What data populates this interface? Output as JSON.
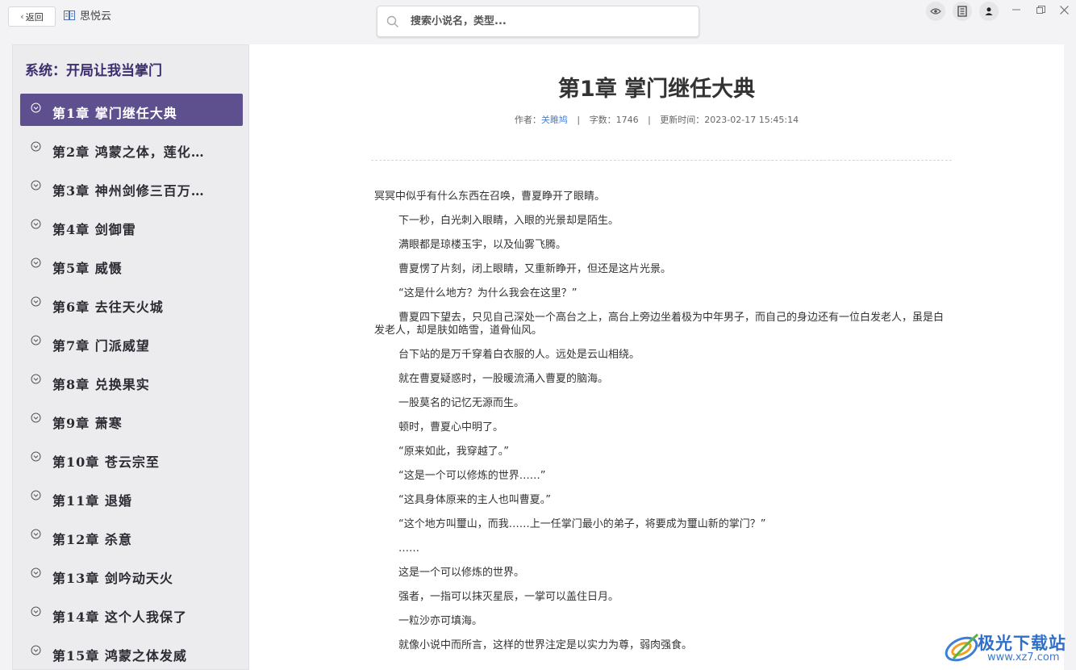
{
  "topbar": {
    "back_label": "返回",
    "app_name": "思悦云",
    "search_placeholder": "搜索小说名，类型..."
  },
  "sidebar": {
    "book_title": "系统：开局让我当掌门",
    "chapters": [
      {
        "label": "第1章  掌门继任大典",
        "active": true
      },
      {
        "label": "第2章  鸿蒙之体，莲化…",
        "active": false
      },
      {
        "label": "第3章  神州剑修三百万…",
        "active": false
      },
      {
        "label": "第4章  剑御雷",
        "active": false
      },
      {
        "label": "第5章  威慑",
        "active": false
      },
      {
        "label": "第6章  去往天火城",
        "active": false
      },
      {
        "label": "第7章  门派威望",
        "active": false
      },
      {
        "label": "第8章  兑换果实",
        "active": false
      },
      {
        "label": "第9章  萧寒",
        "active": false
      },
      {
        "label": "第10章  苍云宗至",
        "active": false
      },
      {
        "label": "第11章  退婚",
        "active": false
      },
      {
        "label": "第12章  杀意",
        "active": false
      },
      {
        "label": "第13章  剑吟动天火",
        "active": false
      },
      {
        "label": "第14章  这个人我保了",
        "active": false
      },
      {
        "label": "第15章  鸿蒙之体发威",
        "active": false
      }
    ]
  },
  "reader": {
    "title": "第1章 掌门继任大典",
    "author_label": "作者：",
    "author": "关雎鸠",
    "sep": "|",
    "word_count": "字数：1746",
    "updated": "更新时间：2023-02-17 15:45:14",
    "paragraphs": [
      "冥冥中似乎有什么东西在召唤，曹夏睁开了眼睛。",
      "下一秒，白光刺入眼睛，入眼的光景却是陌生。",
      "满眼都是琼楼玉宇，以及仙雾飞腾。",
      "曹夏愣了片刻，闭上眼睛，又重新睁开，但还是这片光景。",
      "“这是什么地方？为什么我会在这里？”",
      "曹夏四下望去，只见自己深处一个高台之上，高台上旁边坐着极为中年男子，而自己的身边还有一位白发老人，虽是白发老人，却是肤如皓雪，道骨仙风。",
      "台下站的是万千穿着白衣服的人。远处是云山相绕。",
      "就在曹夏疑惑时，一股暖流涌入曹夏的脑海。",
      "一股莫名的记忆无源而生。",
      "顿时，曹夏心中明了。",
      "“原来如此，我穿越了。”",
      "“这是一个可以修炼的世界……”",
      "“这具身体原来的主人也叫曹夏。”",
      "“这个地方叫璽山，而我……上一任掌门最小的弟子，将要成为璽山新的掌门？”",
      "……",
      "这是一个可以修炼的世界。",
      "强者，一指可以抹灭星辰，一掌可以盖住日月。",
      "一粒沙亦可填海。",
      "就像小说中而所言，这样的世界注定是以实力为尊，弱肉强食。"
    ]
  },
  "watermark": {
    "line1": "极光下载站",
    "line2": "www.xz7.com"
  },
  "colors": {
    "active_chapter": "#5e4f8f",
    "book_title": "#3b2d6e",
    "author_link": "#4a7fd0"
  }
}
